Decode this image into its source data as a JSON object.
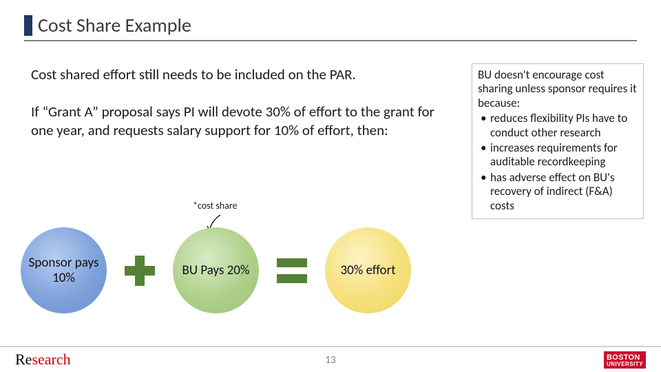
{
  "title": "Cost Share Example",
  "body": {
    "p1": "Cost shared effort still needs to be included on the PAR.",
    "p2": "If “Grant A” proposal says PI will devote 30% of effort to the grant for one year, and requests salary support for 10% of effort, then:"
  },
  "annotation": "*cost share",
  "circles": {
    "sponsor": "Sponsor pays 10%",
    "bu": "BU Pays 20%",
    "effort": "30% effort"
  },
  "note": {
    "lead": "BU doesn't encourage cost sharing unless sponsor requires it because:",
    "bullets": [
      "reduces flexibility PIs have to conduct other research",
      "increases requirements for auditable recordkeeping",
      "has adverse effect on BU's recovery of indirect (F&A) costs"
    ]
  },
  "footer": {
    "brand_re": "Re",
    "brand_search": "search",
    "page": "13",
    "bu1": "BOSTON",
    "bu2": "UNIVERSITY"
  }
}
